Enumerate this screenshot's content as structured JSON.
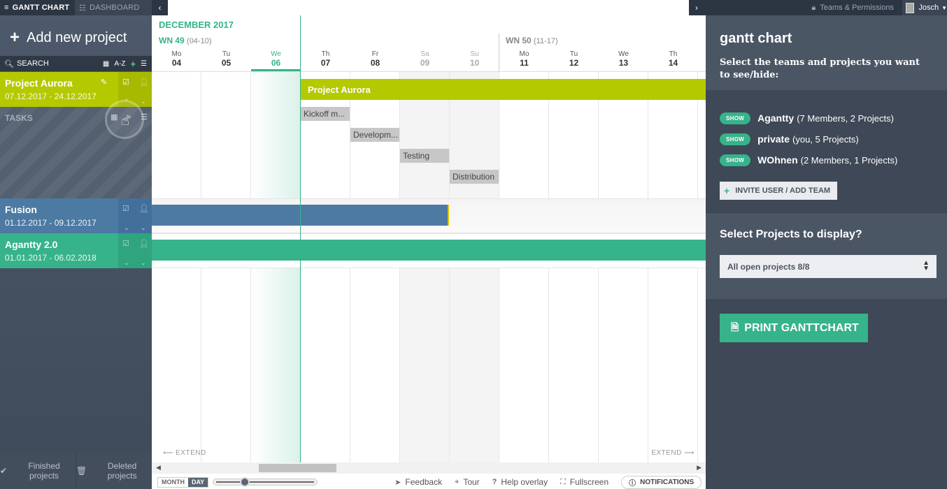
{
  "tabs": {
    "gantt": "GANTT CHART",
    "dashboard": "DASHBOARD"
  },
  "sidebar": {
    "add_project": "Add new project",
    "search_label": "SEARCH",
    "sort_label": "A-Z",
    "tasks_label": "TASKS",
    "projects": [
      {
        "name": "Project Aurora",
        "dates": "07.12.2017 - 24.12.2017",
        "color": "#b5c900"
      },
      {
        "name": "Fusion",
        "dates": "01.12.2017 - 09.12.2017",
        "color": "#4c7aa3"
      },
      {
        "name": "Agantty 2.0",
        "dates": "01.01.2017 - 06.02.2018",
        "color": "#36b38a"
      }
    ],
    "finished_projects": "Finished projects",
    "deleted_projects": "Deleted projects"
  },
  "timeline": {
    "month": "DECEMBER 2017",
    "weeks": [
      {
        "label": "WN 49",
        "range": "(04-10)"
      },
      {
        "label": "WN 50",
        "range": "(11-17)"
      }
    ],
    "days": [
      {
        "name": "Mo",
        "num": "04"
      },
      {
        "name": "Tu",
        "num": "05"
      },
      {
        "name": "We",
        "num": "06"
      },
      {
        "name": "Th",
        "num": "07"
      },
      {
        "name": "Fr",
        "num": "08"
      },
      {
        "name": "Sa",
        "num": "09"
      },
      {
        "name": "Su",
        "num": "10"
      },
      {
        "name": "Mo",
        "num": "11"
      },
      {
        "name": "Tu",
        "num": "12"
      },
      {
        "name": "We",
        "num": "13"
      },
      {
        "name": "Th",
        "num": "14"
      }
    ],
    "bars": {
      "aurora": "Project Aurora"
    },
    "tasks": [
      "Kickoff m...",
      "Developm...",
      "Testing",
      "Distribution"
    ],
    "extend_left": "EXTEND",
    "extend_right": "EXTEND"
  },
  "toolbar": {
    "month": "MONTH",
    "day": "DAY",
    "feedback": "Feedback",
    "tour": "Tour",
    "help": "Help overlay",
    "fullscreen": "Fullscreen",
    "notifications": "NOTIFICATIONS"
  },
  "topbar": {
    "teams_permissions": "Teams & Permissions",
    "user": "Josch"
  },
  "right_panel": {
    "title": "gantt chart",
    "subtitle": "Select the teams and projects you want to see/hide:",
    "show_label": "SHOW",
    "teams": [
      {
        "name": "Agantty",
        "meta": "(7 Members, 2 Projects)"
      },
      {
        "name": "private",
        "meta": "(you, 5 Projects)"
      },
      {
        "name": "WOhnen",
        "meta": "(2 Members, 1 Projects)"
      }
    ],
    "invite_button": "INVITE USER / ADD TEAM",
    "select_title": "Select Projects to display?",
    "select_value": "All open projects 8/8",
    "print_button": "PRINT GANTTCHART"
  },
  "colors": {
    "accent": "#36b38a",
    "aurora": "#b5c900",
    "fusion": "#4c7aa3",
    "sidebar": "#4d5a6b"
  }
}
